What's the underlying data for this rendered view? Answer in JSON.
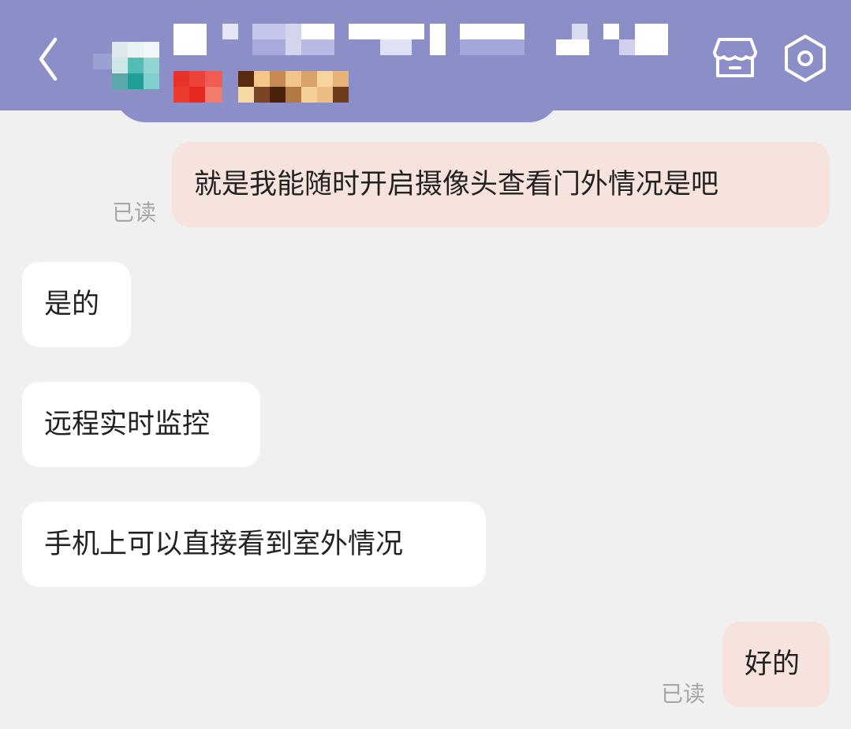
{
  "header": {
    "back_icon": "chevron-left-icon",
    "store_icon": "store-icon",
    "settings_icon": "hexagon-gear-icon",
    "title_obscured": true,
    "subtitle_obscured": true,
    "bar_color": "#8b8ec7"
  },
  "messages": [
    {
      "side": "sent",
      "text": "就是我能随时开启摄像头查看门外情况是吧",
      "read_label": "已读"
    },
    {
      "side": "received",
      "text": "是的"
    },
    {
      "side": "received",
      "text": "远程实时监控"
    },
    {
      "side": "received",
      "text": "手机上可以直接看到室外情况"
    },
    {
      "side": "sent",
      "text": "好的",
      "read_label": "已读"
    }
  ],
  "colors": {
    "sent_bubble": "#f7e3dd",
    "received_bubble": "#ffffff",
    "chat_background": "#f0f0f0",
    "read_label": "#a6a6a6"
  }
}
